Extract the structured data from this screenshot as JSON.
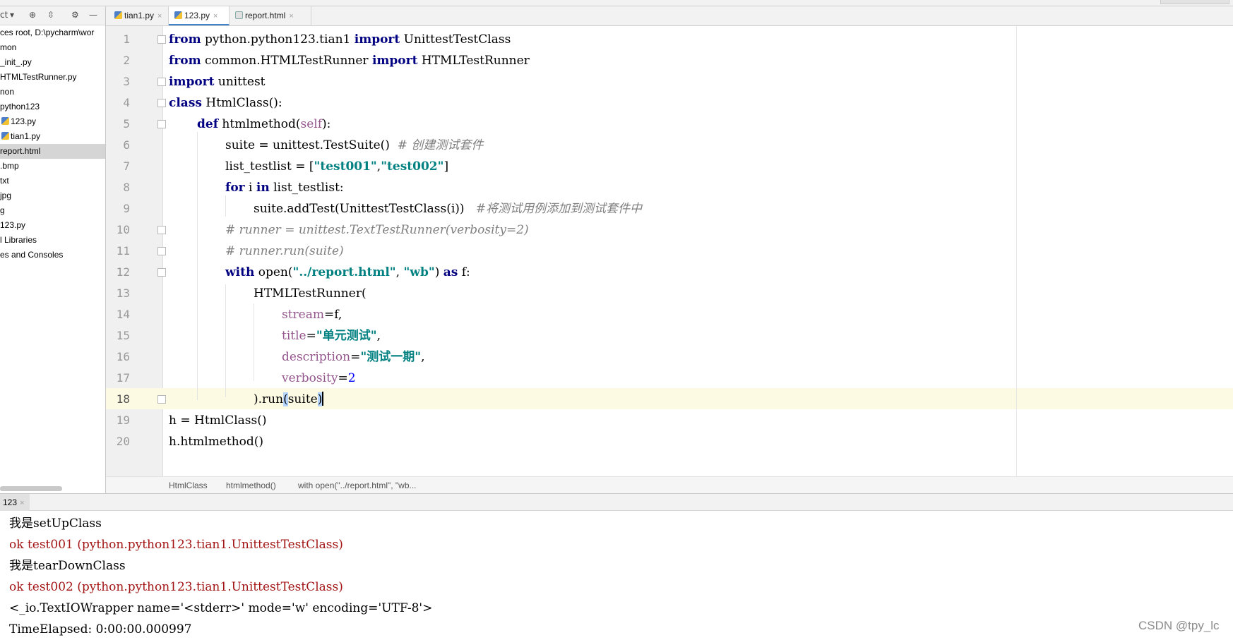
{
  "sidebar": {
    "toolbar": {
      "view": "ct",
      "dropdown": "▾",
      "locate": "⊕",
      "collapse": "⇳",
      "gear": "⚙",
      "hide": "—"
    },
    "items": [
      {
        "label": "ces root,  D:\\pycharm\\wor",
        "selected": false,
        "icon": ""
      },
      {
        "label": "mon",
        "selected": false,
        "icon": ""
      },
      {
        "label": "_init_.py",
        "selected": false,
        "icon": ""
      },
      {
        "label": "HTMLTestRunner.py",
        "selected": false,
        "icon": ""
      },
      {
        "label": "non",
        "selected": false,
        "icon": ""
      },
      {
        "label": "python123",
        "selected": false,
        "icon": ""
      },
      {
        "label": "123.py",
        "selected": false,
        "icon": "python-file-icon"
      },
      {
        "label": "tian1.py",
        "selected": false,
        "icon": "python-file-icon"
      },
      {
        "label": "report.html",
        "selected": true,
        "icon": ""
      },
      {
        "label": ".bmp",
        "selected": false,
        "icon": ""
      },
      {
        "label": "txt",
        "selected": false,
        "icon": ""
      },
      {
        "label": "jpg",
        "selected": false,
        "icon": ""
      },
      {
        "label": "g",
        "selected": false,
        "icon": ""
      },
      {
        "label": "123.py",
        "selected": false,
        "icon": ""
      },
      {
        "label": "l Libraries",
        "selected": false,
        "icon": ""
      },
      {
        "label": "es and Consoles",
        "selected": false,
        "icon": ""
      }
    ]
  },
  "editor_tabs": [
    {
      "label": "tian1.py",
      "close": "×"
    },
    {
      "label": "123.py",
      "close": "×"
    },
    {
      "label": "report.html",
      "close": "×"
    }
  ],
  "code": {
    "line_numbers": [
      "1",
      "2",
      "3",
      "4",
      "5",
      "6",
      "7",
      "8",
      "9",
      "10",
      "11",
      "12",
      "13",
      "14",
      "15",
      "16",
      "17",
      "18",
      "19",
      "20"
    ],
    "l1": {
      "k1": "from",
      "t1": " python.python123.tian1 ",
      "k2": "import",
      "t2": " UnittestTestClass"
    },
    "l2": {
      "k1": "from",
      "t1": " common.HTMLTestRunner ",
      "k2": "import",
      "t2": " HTMLTestRunner"
    },
    "l3": {
      "k1": "import",
      "t1": " unittest"
    },
    "l4": {
      "k1": "class",
      "t1": " HtmlClass():"
    },
    "l5": {
      "k1": "def",
      "t1": " htmlmethod(",
      "s1": "self",
      "t2": "):"
    },
    "l6": {
      "t1": "suite = unittest.TestSuite()  ",
      "c1": "# 创建测试套件"
    },
    "l7": {
      "t1": "list_testlist = [",
      "s1": "\"test001\"",
      "t2": ",",
      "s2": "\"test002\"",
      "t3": "]"
    },
    "l8": {
      "k1": "for",
      "t1": " i ",
      "k2": "in",
      "t2": " list_testlist:"
    },
    "l9": {
      "t1": "suite.addTest(UnittestTestClass(i))   ",
      "c1": "#将测试用例添加到测试套件中"
    },
    "l10": {
      "c1": "# runner = unittest.TextTestRunner(verbosity=2)"
    },
    "l11": {
      "c1": "# runner.run(suite)"
    },
    "l12": {
      "k1": "with",
      "t1": " open(",
      "s1": "\"../report.html\"",
      "t2": ", ",
      "s2": "\"wb\"",
      "t3": ") ",
      "k2": "as",
      "t4": " f:"
    },
    "l13": {
      "t1": "HTMLTestRunner("
    },
    "l14": {
      "p1": "stream",
      "t1": "=f,"
    },
    "l15": {
      "p1": "title",
      "t1": "=",
      "s1": "\"单元测试\"",
      "t2": ","
    },
    "l16": {
      "p1": "description",
      "t1": "=",
      "s1": "\"测试一期\"",
      "t2": ","
    },
    "l17": {
      "p1": "verbosity",
      "t1": "=",
      "n1": "2"
    },
    "l18": {
      "t1": ").run",
      "h1": "(",
      "t2": "suite",
      "h2": ")"
    },
    "l19": {
      "t1": "h = HtmlClass()"
    },
    "l20": {
      "t1": "h.htmlmethod()"
    }
  },
  "breadcrumb": [
    "HtmlClass",
    "htmlmethod()",
    "with open(\"../report.html\", \"wb..."
  ],
  "run_panel": {
    "tab_label": "123",
    "close": "×",
    "lines": [
      "我是setUpClass",
      "ok test001 (python.python123.tian1.UnittestTestClass)",
      "我是tearDownClass",
      "ok test002 (python.python123.tian1.UnittestTestClass)",
      "<_io.TextIOWrapper name='<stderr>' mode='w' encoding='UTF-8'>",
      "TimeElapsed: 0:00:00.000997"
    ]
  },
  "watermark": "CSDN @tpy_lc"
}
